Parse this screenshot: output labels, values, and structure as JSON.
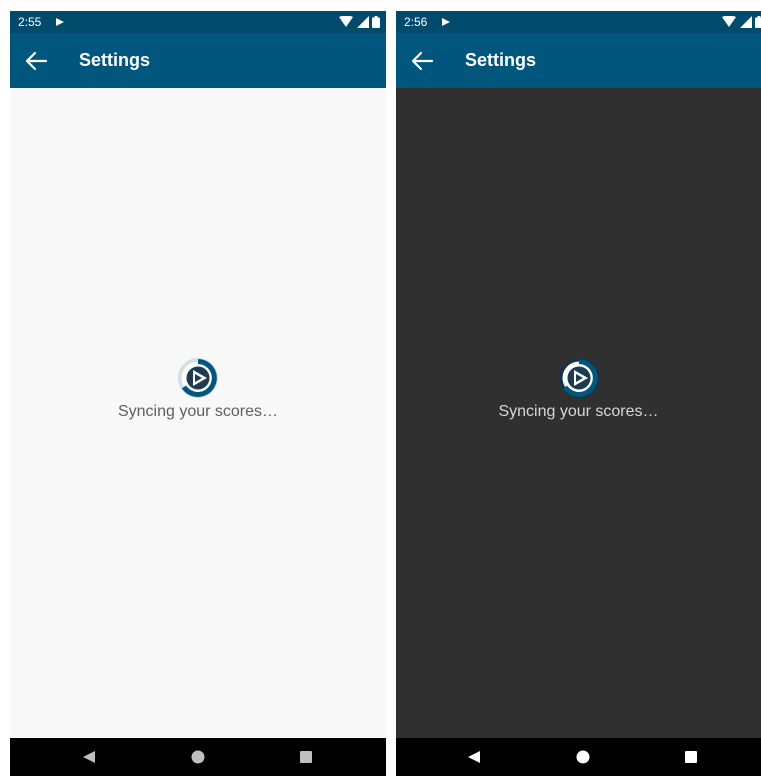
{
  "screens": [
    {
      "theme": "light",
      "status_time": "2:55",
      "app_bar_title": "Settings",
      "loading_text": "Syncing your scores…"
    },
    {
      "theme": "dark",
      "status_time": "2:56",
      "app_bar_title": "Settings",
      "loading_text": "Syncing your scores…"
    }
  ],
  "icons": {
    "back": "arrow-left-icon",
    "status_left": "play-store-icon",
    "status_right": [
      "wifi-icon",
      "signal-icon",
      "battery-icon"
    ],
    "loader": "app-logo-play-icon",
    "nav": [
      "nav-back-icon",
      "nav-home-icon",
      "nav-recents-icon"
    ]
  },
  "colors": {
    "status_bar": "#004a6b",
    "app_bar": "#00567d",
    "light_background": "#f8f8f8",
    "dark_background": "#303030",
    "nav_bar": "#000000"
  }
}
